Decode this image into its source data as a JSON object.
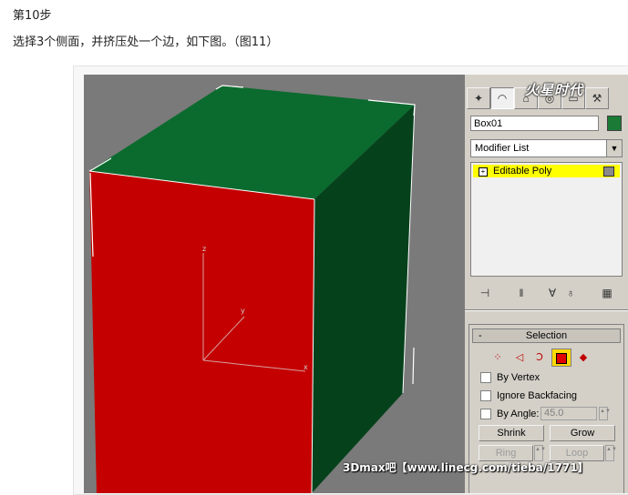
{
  "article": {
    "step_title": "第10步",
    "description": "选择3个侧面，并挤压处一个边，如下图。（图11）"
  },
  "viewport": {
    "axis_x": "x",
    "axis_y": "y",
    "axis_z": "z",
    "colors": {
      "front_face": "#c40000",
      "top_face": "#0b6b2e",
      "side_face": "#05421c",
      "background": "#7a7a7a"
    }
  },
  "command_panel": {
    "logo": "火星时代",
    "tabs": [
      "create-icon",
      "modify-icon",
      "hierarchy-icon",
      "motion-icon",
      "display-icon",
      "utilities-icon"
    ],
    "object_name": "Box01",
    "object_color": "#1a7a36",
    "modifier_list": "Modifier List",
    "stack": [
      {
        "label": "Editable Poly",
        "expand": "+"
      }
    ],
    "stack_tools": [
      "pin-stack-icon",
      "show-end-result-icon",
      "make-unique-icon",
      "remove-modifier-icon",
      "configure-modifier-sets-icon"
    ],
    "selection": {
      "header": "Selection",
      "collapse": "-",
      "subobjects": [
        "vertex-icon",
        "edge-icon",
        "border-icon",
        "polygon-icon",
        "element-icon"
      ],
      "by_vertex": "By Vertex",
      "ignore_backfacing": "Ignore Backfacing",
      "by_angle": "By Angle:",
      "angle_value": "45.0",
      "shrink": "Shrink",
      "grow": "Grow",
      "ring": "Ring",
      "loop": "Loop"
    }
  },
  "watermark": "3Dmax吧【www.linecg.com/tieba/1771】"
}
